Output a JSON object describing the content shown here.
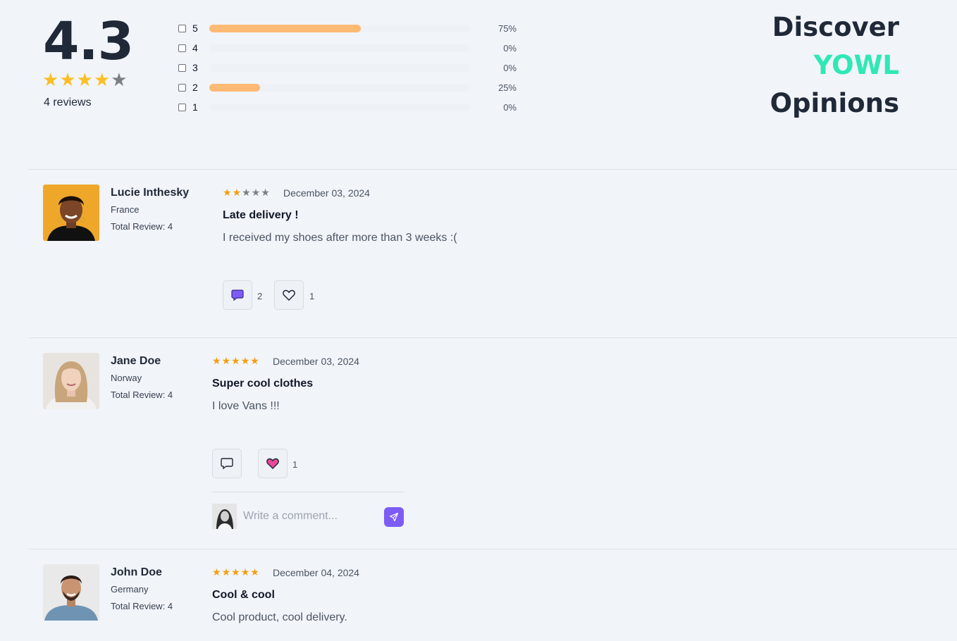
{
  "summary": {
    "average": "4.3",
    "average_stars": 4,
    "max_stars": 5,
    "reviews_count_label": "4 reviews",
    "distribution": [
      {
        "label": "5",
        "percent_label": "75%",
        "fraction": 0.75
      },
      {
        "label": "4",
        "percent_label": "0%",
        "fraction": 0
      },
      {
        "label": "3",
        "percent_label": "0%",
        "fraction": 0
      },
      {
        "label": "2",
        "percent_label": "25%",
        "fraction": 0.25
      },
      {
        "label": "1",
        "percent_label": "0%",
        "fraction": 0
      }
    ],
    "bar_color": "#fdba74"
  },
  "brand": {
    "line1": "Discover",
    "line2": "YOWL",
    "line3": "Opinions",
    "accent_color": "#2ee8b6"
  },
  "reviews": [
    {
      "author": "Lucie Inthesky",
      "country": "France",
      "total": "Total Review: 4",
      "rating": 2,
      "date": "December 03, 2024",
      "title": "Late delivery !",
      "body": "I received my shoes after more than 3 weeks :(",
      "comments_count": "2",
      "likes_count": "1",
      "comment_icon": "speech-bubble-filled-purple",
      "like_icon": "heart-outline"
    },
    {
      "author": "Jane Doe",
      "country": "Norway",
      "total": "Total Review: 4",
      "rating": 5,
      "date": "December 03, 2024",
      "title": "Super cool clothes",
      "body": "I love Vans !!!",
      "likes_count": "1",
      "comment_icon": "speech-bubble-outline",
      "like_icon": "heart-filled-pink",
      "comment_placeholder": "Write a comment..."
    },
    {
      "author": "John Doe",
      "country": "Germany",
      "total": "Total Review: 4",
      "rating": 5,
      "date": "December 04, 2024",
      "title": "Cool & cool",
      "body": "Cool product, cool delivery."
    }
  ],
  "colors": {
    "star": "#f59e0b",
    "send_button": "#7c5cf5",
    "heart": "#ec4899",
    "comment_filled": "#7c5cf5"
  }
}
